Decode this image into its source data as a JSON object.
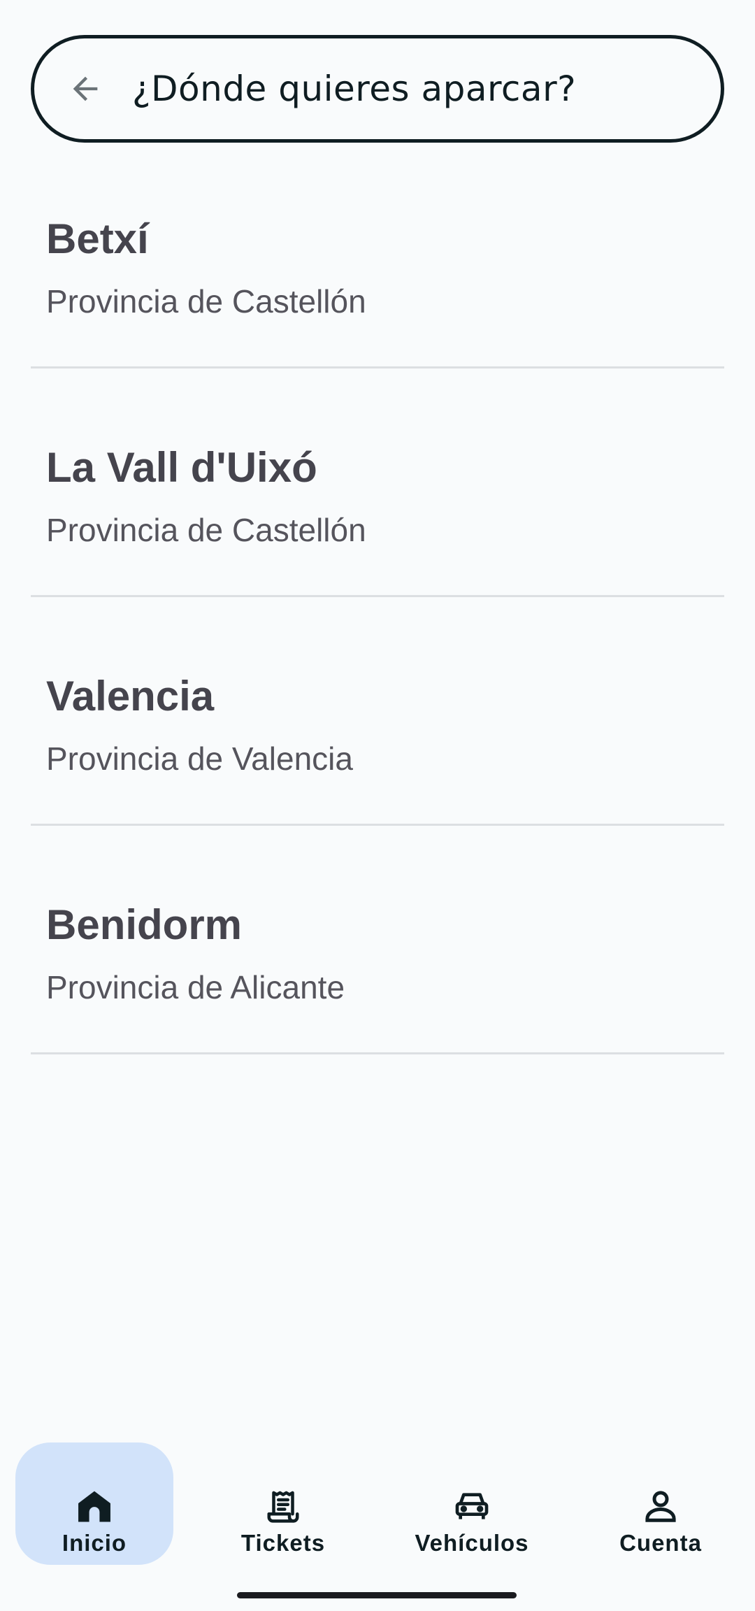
{
  "search": {
    "placeholder": "¿Dónde quieres aparcar?"
  },
  "results": [
    {
      "name": "Betxí",
      "province": "Provincia de Castellón"
    },
    {
      "name": "La Vall d'Uixó",
      "province": "Provincia de Castellón"
    },
    {
      "name": "Valencia",
      "province": "Provincia de Valencia"
    },
    {
      "name": "Benidorm",
      "province": "Provincia de Alicante"
    }
  ],
  "nav": {
    "items": [
      {
        "label": "Inicio",
        "icon": "home-icon",
        "active": true
      },
      {
        "label": "Tickets",
        "icon": "receipt-icon",
        "active": false
      },
      {
        "label": "Vehículos",
        "icon": "car-icon",
        "active": false
      },
      {
        "label": "Cuenta",
        "icon": "person-icon",
        "active": false
      }
    ]
  },
  "colors": {
    "background": "#f9fbfc",
    "ink": "#0f1d22",
    "active_nav": "#d2e3fa",
    "divider": "#dcdfe2"
  }
}
